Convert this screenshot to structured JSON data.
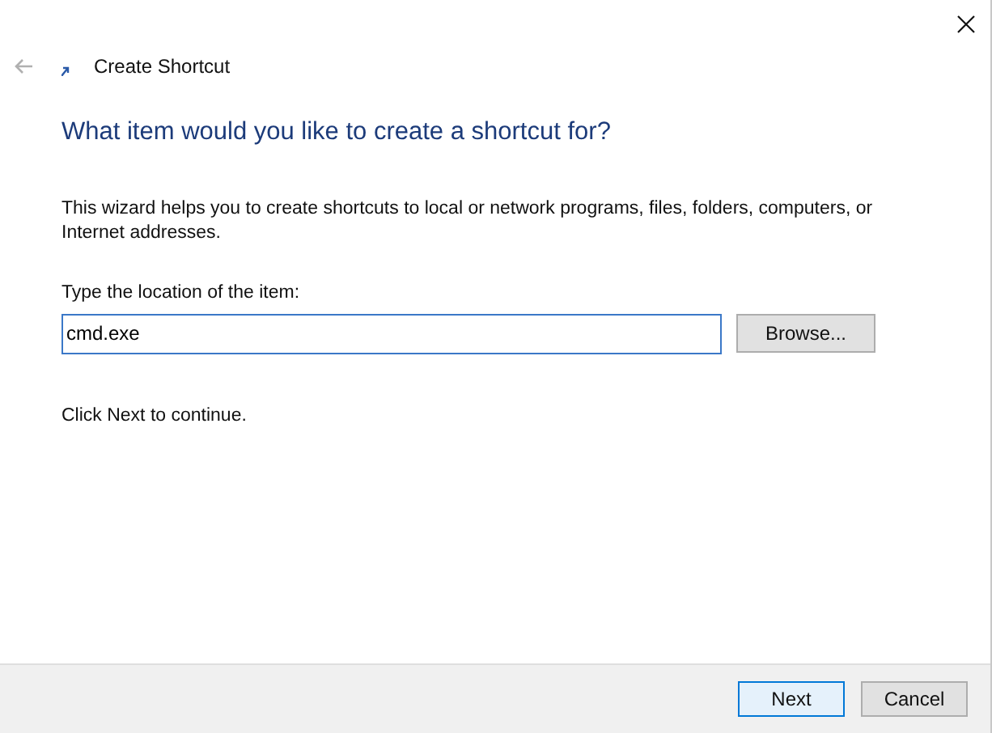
{
  "window": {
    "title": "Create Shortcut",
    "back_disabled": true
  },
  "heading": "What item would you like to create a shortcut for?",
  "description": "This wizard helps you to create shortcuts to local or network programs, files, folders, computers, or Internet addresses.",
  "location": {
    "label": "Type the location of the item:",
    "value": "cmd.exe",
    "focused": true
  },
  "browse_button": "Browse...",
  "hint": "Click Next to continue.",
  "buttons": [
    {
      "label": "Next",
      "default": true
    },
    {
      "label": "Cancel",
      "default": false
    }
  ]
}
